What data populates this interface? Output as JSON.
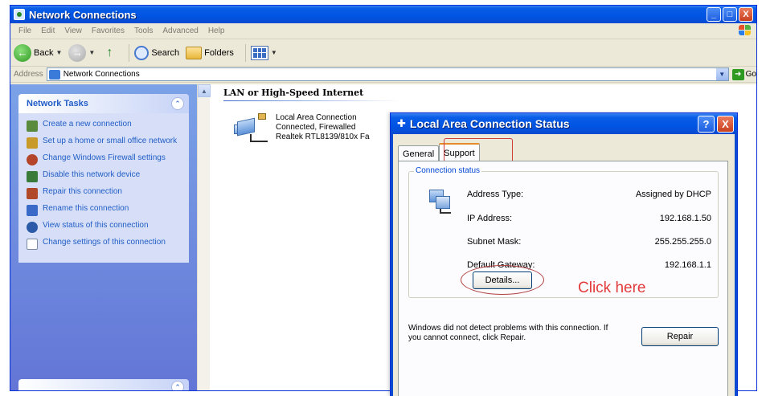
{
  "window": {
    "title": "Network Connections",
    "controls": [
      "_",
      "□",
      "X"
    ]
  },
  "menu": [
    "File",
    "Edit",
    "View",
    "Favorites",
    "Tools",
    "Advanced",
    "Help"
  ],
  "toolbar": {
    "back_label": "Back",
    "search_label": "Search",
    "folders_label": "Folders"
  },
  "address": {
    "label": "Address",
    "value": "Network Connections",
    "go_label": "Go"
  },
  "sidebar": {
    "title": "Network Tasks",
    "collapse_glyph": "⌃",
    "items": [
      {
        "label": "Create a new connection",
        "color": "#5a8a3c"
      },
      {
        "label": "Set up a home or small office network",
        "color": "#c89a2a"
      },
      {
        "label": "Change Windows Firewall settings",
        "color": "#b5452a"
      },
      {
        "label": "Disable this network device",
        "color": "#3a7a3a"
      },
      {
        "label": "Repair this connection",
        "color": "#b04a2a"
      },
      {
        "label": "Rename this connection",
        "color": "#3a6ac8"
      },
      {
        "label": "View status of this connection",
        "color": "#2a5aa8"
      },
      {
        "label": "Change settings of this connection",
        "color": "#7a8aa8"
      }
    ]
  },
  "content": {
    "group_header": "LAN or High-Speed Internet",
    "connection": {
      "name": "Local Area Connection",
      "status": "Connected, Firewalled",
      "adapter": "Realtek RTL8139/810x Fa"
    }
  },
  "dialog": {
    "title": "Local Area Connection Status",
    "help_glyph": "?",
    "close_glyph": "X",
    "tabs": [
      {
        "label": "General",
        "active": false
      },
      {
        "label": "Support",
        "active": true
      }
    ],
    "group_label": "Connection status",
    "fields": [
      {
        "label": "Address Type:",
        "value": "Assigned by DHCP"
      },
      {
        "label": "IP Address:",
        "value": "192.168.1.50"
      },
      {
        "label": "Subnet Mask:",
        "value": "255.255.255.0"
      },
      {
        "label": "Default Gateway:",
        "value": "192.168.1.1"
      }
    ],
    "details_label": "Details...",
    "annotation": "Click here",
    "diagnosis": "Windows did not detect problems with this connection. If you cannot connect, click Repair.",
    "repair_label": "Repair"
  },
  "colors": {
    "title_blue": "#0054e3",
    "task_pane": "#6375d6",
    "annotation_red": "#e23a3a",
    "close_red": "#c8401f"
  }
}
